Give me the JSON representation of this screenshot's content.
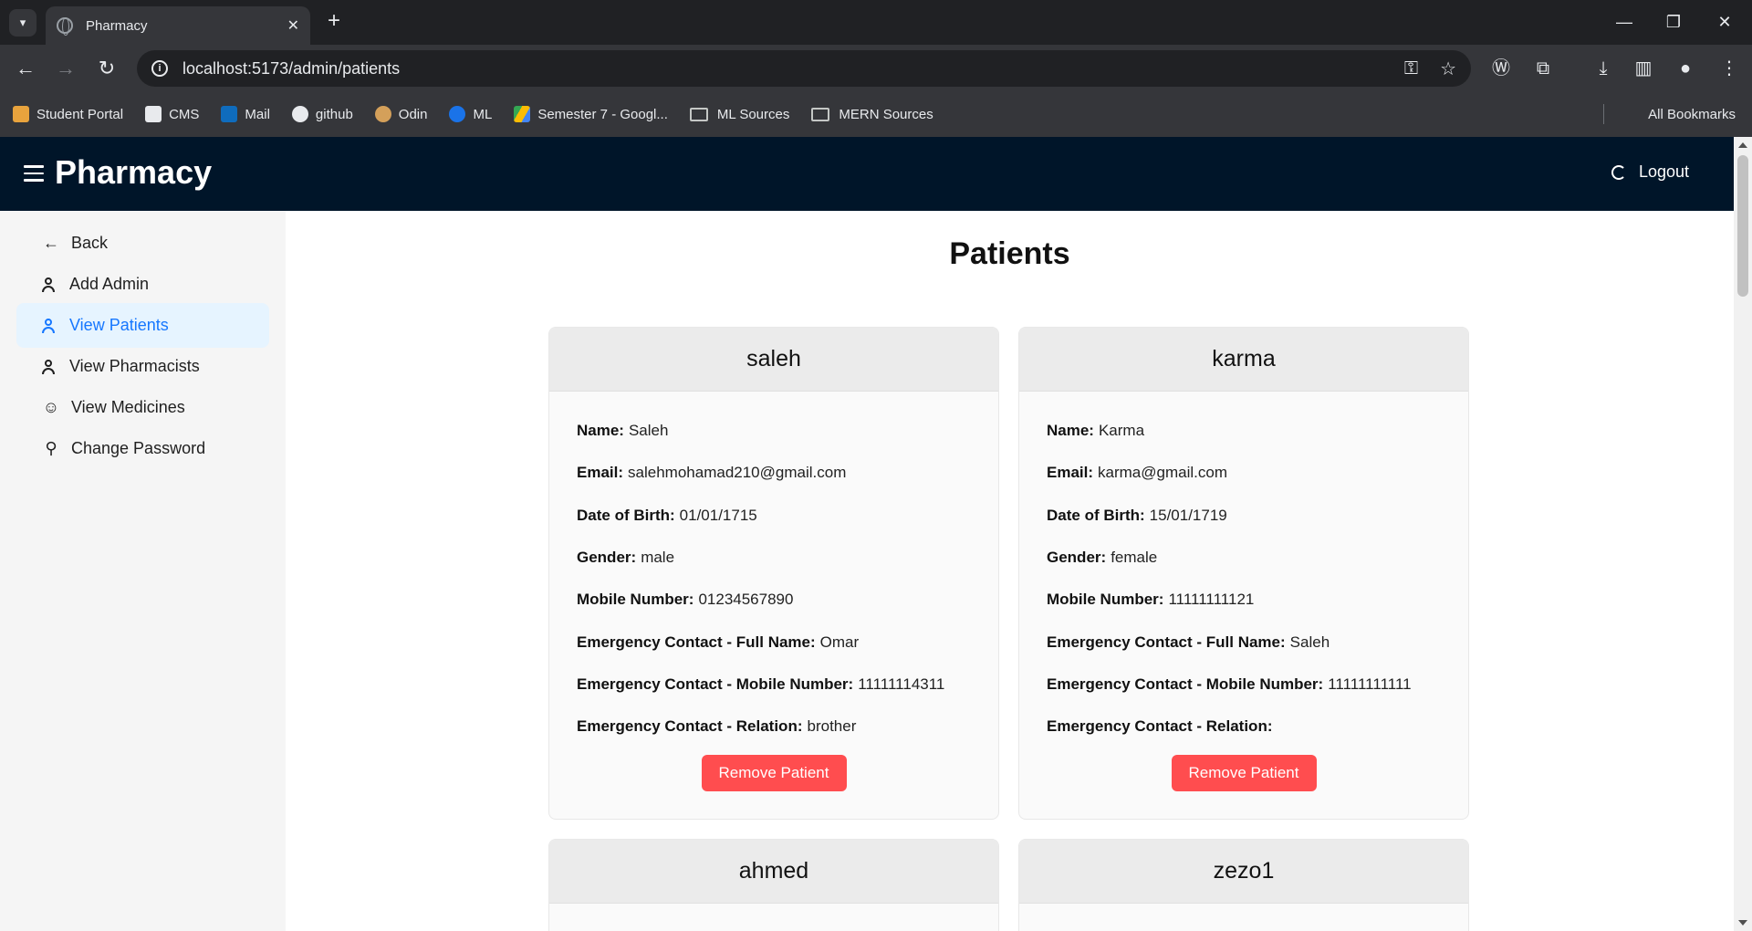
{
  "browser": {
    "tab_title": "Pharmacy",
    "url": "localhost:5173/admin/patients",
    "bookmarks": [
      "Student Portal",
      "CMS",
      "Mail",
      "github",
      "Odin",
      "ML",
      "Semester 7 - Googl...",
      "ML Sources",
      "MERN Sources"
    ],
    "all_bookmarks": "All Bookmarks"
  },
  "header": {
    "title": "Pharmacy",
    "logout": "Logout"
  },
  "sidebar": {
    "items": [
      {
        "label": "Back",
        "icon": "arrow-left-icon"
      },
      {
        "label": "Add Admin",
        "icon": "user-icon"
      },
      {
        "label": "View Patients",
        "icon": "user-icon",
        "active": true
      },
      {
        "label": "View Pharmacists",
        "icon": "user-icon"
      },
      {
        "label": "View Medicines",
        "icon": "message-icon"
      },
      {
        "label": "Change Password",
        "icon": "key-icon"
      }
    ]
  },
  "main": {
    "title": "Patients",
    "labels": {
      "name": "Name:",
      "email": "Email:",
      "dob": "Date of Birth:",
      "gender": "Gender:",
      "mobile": "Mobile Number:",
      "ec_name": "Emergency Contact - Full Name:",
      "ec_mobile": "Emergency Contact - Mobile Number:",
      "ec_relation": "Emergency Contact - Relation:"
    },
    "remove_label": "Remove Patient",
    "patients": [
      {
        "username": "saleh",
        "name": "Saleh",
        "email": "salehmohamad210@gmail.com",
        "dob": "01/01/1715",
        "gender": "male",
        "mobile": "01234567890",
        "ec_name": "Omar",
        "ec_mobile": "11111114311",
        "ec_relation": "brother"
      },
      {
        "username": "karma",
        "name": "Karma",
        "email": "karma@gmail.com",
        "dob": "15/01/1719",
        "gender": "female",
        "mobile": "11111111121",
        "ec_name": "Saleh",
        "ec_mobile": "11111111111",
        "ec_relation": ""
      },
      {
        "username": "ahmed"
      },
      {
        "username": "zezo1"
      }
    ]
  },
  "colors": {
    "header_bg": "#001529",
    "accent": "#1677ff",
    "danger": "#ff4d4f"
  }
}
